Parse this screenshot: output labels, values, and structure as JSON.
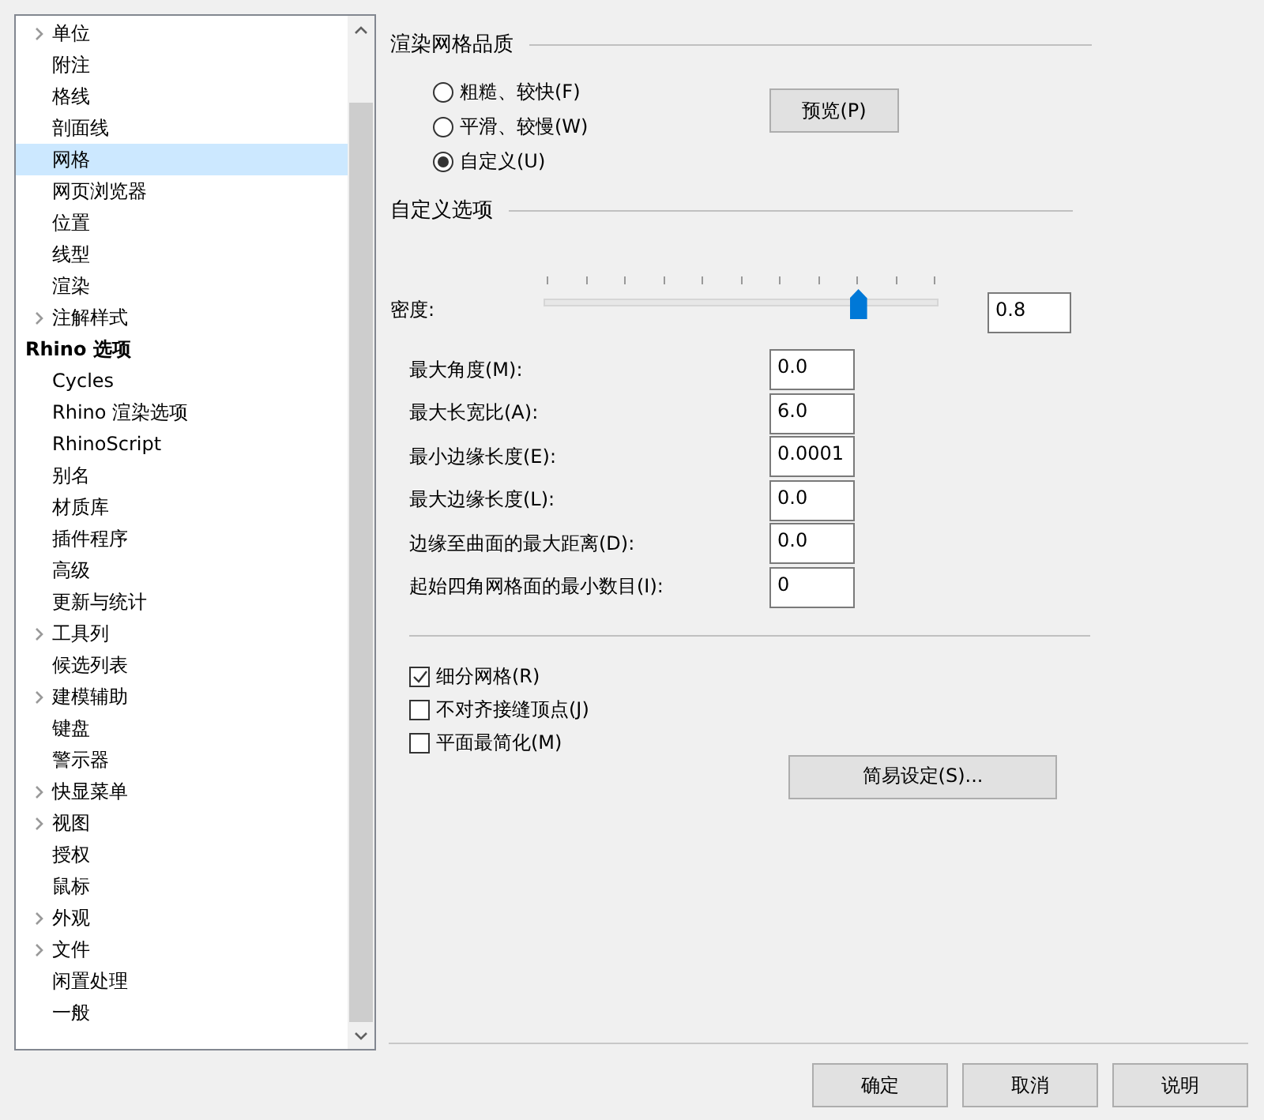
{
  "tree": {
    "nodes": [
      {
        "children": [
          {
            "label": "单位",
            "expandable": true,
            "selected": false
          },
          {
            "label": "附注",
            "expandable": false,
            "selected": false
          },
          {
            "label": "格线",
            "expandable": false,
            "selected": false
          },
          {
            "label": "剖面线",
            "expandable": false,
            "selected": false
          },
          {
            "label": "网格",
            "expandable": false,
            "selected": true
          },
          {
            "label": "网页浏览器",
            "expandable": false,
            "selected": false
          },
          {
            "label": "位置",
            "expandable": false,
            "selected": false
          },
          {
            "label": "线型",
            "expandable": false,
            "selected": false
          },
          {
            "label": "渲染",
            "expandable": false,
            "selected": false
          },
          {
            "label": "注解样式",
            "expandable": true,
            "selected": false
          }
        ]
      },
      {
        "label": "Rhino 选项",
        "selected": false,
        "children": [
          {
            "label": "Cycles",
            "expandable": false,
            "selected": false
          },
          {
            "label": "Rhino 渲染选项",
            "expandable": false,
            "selected": false
          },
          {
            "label": "RhinoScript",
            "expandable": false,
            "selected": false
          },
          {
            "label": "别名",
            "expandable": false,
            "selected": false
          },
          {
            "label": "材质库",
            "expandable": false,
            "selected": false
          },
          {
            "label": "插件程序",
            "expandable": false,
            "selected": false
          },
          {
            "label": "高级",
            "expandable": false,
            "selected": false
          },
          {
            "label": "更新与统计",
            "expandable": false,
            "selected": false
          },
          {
            "label": "工具列",
            "expandable": true,
            "selected": false
          },
          {
            "label": "候选列表",
            "expandable": false,
            "selected": false
          },
          {
            "label": "建模辅助",
            "expandable": true,
            "selected": false
          },
          {
            "label": "键盘",
            "expandable": false,
            "selected": false
          },
          {
            "label": "警示器",
            "expandable": false,
            "selected": false
          },
          {
            "label": "快显菜单",
            "expandable": true,
            "selected": false
          },
          {
            "label": "视图",
            "expandable": true,
            "selected": false
          },
          {
            "label": "授权",
            "expandable": false,
            "selected": false
          },
          {
            "label": "鼠标",
            "expandable": false,
            "selected": false
          },
          {
            "label": "外观",
            "expandable": true,
            "selected": false
          },
          {
            "label": "文件",
            "expandable": true,
            "selected": false
          },
          {
            "label": "闲置处理",
            "expandable": false,
            "selected": false
          },
          {
            "label": "一般",
            "expandable": false,
            "selected": false
          }
        ]
      }
    ]
  },
  "quality": {
    "title": "渲染网格品质",
    "options": [
      {
        "label": "粗糙、较快(F)",
        "selected": false
      },
      {
        "label": "平滑、较慢(W)",
        "selected": false
      },
      {
        "label": "自定义(U)",
        "selected": true
      }
    ],
    "preview_button": "预览(P)"
  },
  "custom": {
    "title": "自定义选项",
    "density": {
      "label": "密度:",
      "level": 0.8,
      "value": "0.8"
    },
    "fields": [
      {
        "label": "最大角度(M):",
        "value": "0.0"
      },
      {
        "label": "最大长宽比(A):",
        "value": "6.0"
      },
      {
        "label": "最小边缘长度(E):",
        "value": "0.0001"
      },
      {
        "label": "最大边缘长度(L):",
        "value": "0.0"
      },
      {
        "label": "边缘至曲面的最大距离(D):",
        "value": "0.0"
      },
      {
        "label": "起始四角网格面的最小数目(I):",
        "value": "0"
      }
    ],
    "checkboxes": [
      {
        "label": "细分网格(R)",
        "checked": true
      },
      {
        "label": "不对齐接缝顶点(J)",
        "checked": false
      },
      {
        "label": "平面最简化(M)",
        "checked": false
      }
    ],
    "simple_button": "简易设定(S)..."
  },
  "buttons": [
    "确定",
    "取消",
    "说明"
  ]
}
